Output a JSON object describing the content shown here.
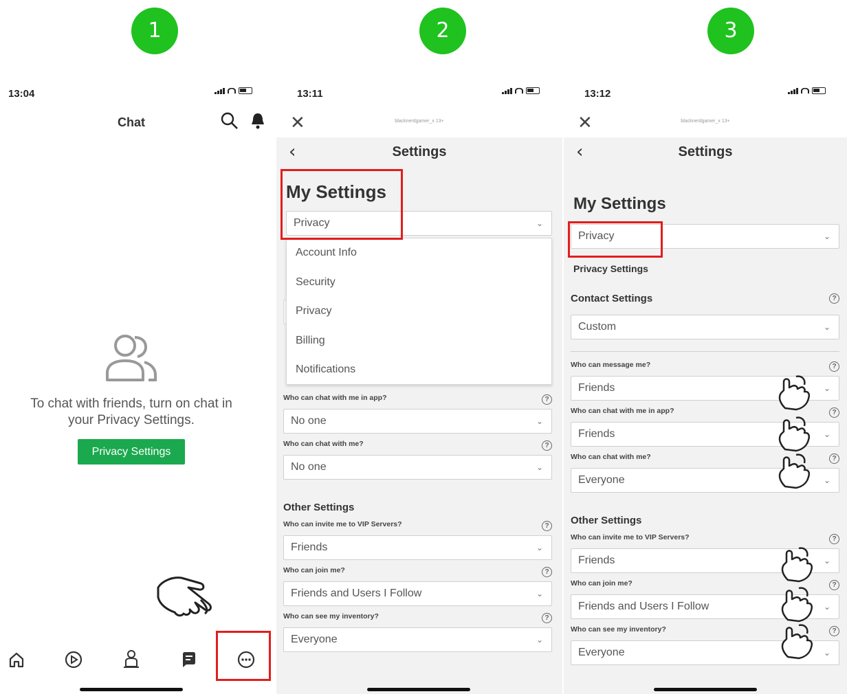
{
  "steps": [
    "1",
    "2",
    "3"
  ],
  "panel1": {
    "time": "13:04",
    "title": "Chat",
    "message_line1": "To chat with friends, turn on chat in",
    "message_line2": "your Privacy Settings.",
    "button": "Privacy Settings",
    "icons": {
      "search": "search-icon",
      "notifications": "bell-icon",
      "friends": "friends-icon",
      "home": "home-icon",
      "discover": "play-icon",
      "avatar": "avatar-icon",
      "chat": "chat-icon",
      "more": "more-icon",
      "hand": "pointing-hand-icon"
    }
  },
  "panel2": {
    "time": "13:11",
    "account": "blacknerdgamer_x 13+",
    "title": "Settings",
    "heading": "My Settings",
    "category_select": "Privacy",
    "dropdown_options": [
      "Account Info",
      "Security",
      "Privacy",
      "Billing",
      "Notifications"
    ],
    "questions": [
      {
        "label": "Who can chat with me in app?",
        "value": "No one"
      },
      {
        "label": "Who can chat with me?",
        "value": "No one"
      }
    ],
    "other_settings": "Other Settings",
    "other_questions": [
      {
        "label": "Who can invite me to VIP Servers?",
        "value": "Friends"
      },
      {
        "label": "Who can join me?",
        "value": "Friends and Users I Follow"
      },
      {
        "label": "Who can see my inventory?",
        "value": "Everyone"
      }
    ]
  },
  "panel3": {
    "time": "13:12",
    "account": "blacknerdgamer_x 13+",
    "title": "Settings",
    "heading": "My Settings",
    "category_select": "Privacy",
    "privacy_settings": "Privacy Settings",
    "contact_settings": "Contact Settings",
    "contact_value": "Custom",
    "questions": [
      {
        "label": "Who can message me?",
        "value": "Friends"
      },
      {
        "label": "Who can chat with me in app?",
        "value": "Friends"
      },
      {
        "label": "Who can chat with me?",
        "value": "Everyone"
      }
    ],
    "other_settings": "Other Settings",
    "other_questions": [
      {
        "label": "Who can invite me to VIP Servers?",
        "value": "Friends"
      },
      {
        "label": "Who can join me?",
        "value": "Friends and Users I Follow"
      },
      {
        "label": "Who can see my inventory?",
        "value": "Everyone"
      }
    ]
  },
  "glyphs": {
    "close": "✕",
    "back": "‹",
    "chevron": "⌄",
    "help": "?",
    "hand": "☝"
  },
  "colors": {
    "step": "#1fc21f",
    "highlight": "#e21d1d",
    "button": "#1aa94e"
  }
}
